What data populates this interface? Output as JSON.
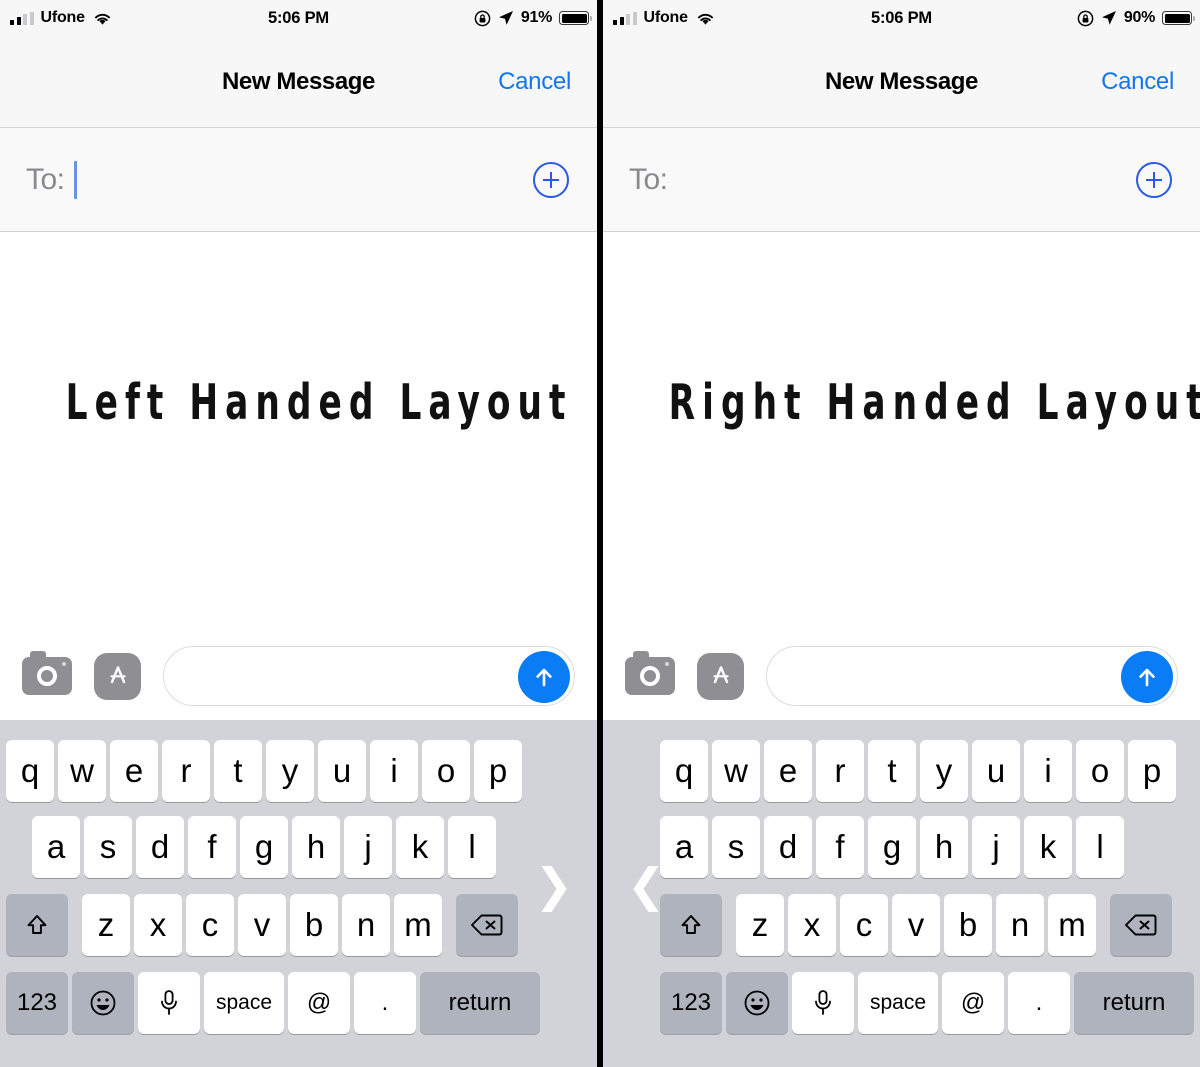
{
  "panels": [
    {
      "id": "left",
      "status": {
        "carrier": "Ufone",
        "time": "5:06 PM",
        "battery_pct": "91%",
        "signal_bars_filled": 2,
        "signal_bars_total": 4,
        "wifi_icon": "wifi-icon",
        "rotation_lock_icon": "rotation-lock-icon",
        "location_icon": "location-arrow-icon",
        "battery_icon": "battery-full-icon"
      },
      "nav": {
        "title": "New Message",
        "cancel_label": "Cancel"
      },
      "recipients": {
        "to_label": "To:",
        "value": "",
        "caret_visible": true,
        "add_contact_icon": "plus-circle-icon"
      },
      "headline": "Left Handed Layout",
      "input_bar": {
        "camera_icon": "camera-icon",
        "appstore_icon": "app-store-icon",
        "message_placeholder": "",
        "message_value": "",
        "send_icon": "send-arrow-up-icon"
      },
      "keyboard": {
        "align": "left",
        "row1": [
          "q",
          "w",
          "e",
          "r",
          "t",
          "y",
          "u",
          "i",
          "o",
          "p"
        ],
        "row2": [
          "a",
          "s",
          "d",
          "f",
          "g",
          "h",
          "j",
          "k",
          "l"
        ],
        "row3": [
          "z",
          "x",
          "c",
          "v",
          "b",
          "n",
          "m"
        ],
        "shift_icon": "shift-arrow-up-icon",
        "backspace_icon": "backspace-delete-icon",
        "numbers_label": "123",
        "emoji_icon": "emoji-smiley-icon",
        "dictation_icon": "microphone-icon",
        "space_label": "space",
        "at_label": "@",
        "period_label": ".",
        "return_label": "return",
        "switch_side_chevron": "chevron-right-icon"
      }
    },
    {
      "id": "right",
      "status": {
        "carrier": "Ufone",
        "time": "5:06 PM",
        "battery_pct": "90%",
        "signal_bars_filled": 2,
        "signal_bars_total": 4,
        "wifi_icon": "wifi-icon",
        "rotation_lock_icon": "rotation-lock-icon",
        "location_icon": "location-arrow-icon",
        "battery_icon": "battery-full-icon"
      },
      "nav": {
        "title": "New Message",
        "cancel_label": "Cancel"
      },
      "recipients": {
        "to_label": "To:",
        "value": "",
        "caret_visible": false,
        "add_contact_icon": "plus-circle-icon"
      },
      "headline": "Right Handed Layout",
      "input_bar": {
        "camera_icon": "camera-icon",
        "appstore_icon": "app-store-icon",
        "message_placeholder": "",
        "message_value": "",
        "send_icon": "send-arrow-up-icon"
      },
      "keyboard": {
        "align": "right",
        "row1": [
          "q",
          "w",
          "e",
          "r",
          "t",
          "y",
          "u",
          "i",
          "o",
          "p"
        ],
        "row2": [
          "a",
          "s",
          "d",
          "f",
          "g",
          "h",
          "j",
          "k",
          "l"
        ],
        "row3": [
          "z",
          "x",
          "c",
          "v",
          "b",
          "n",
          "m"
        ],
        "shift_icon": "shift-arrow-up-icon",
        "backspace_icon": "backspace-delete-icon",
        "numbers_label": "123",
        "emoji_icon": "emoji-smiley-icon",
        "dictation_icon": "microphone-icon",
        "space_label": "space",
        "at_label": "@",
        "period_label": ".",
        "return_label": "return",
        "switch_side_chevron": "chevron-left-icon"
      }
    }
  ],
  "colors": {
    "accent_blue": "#0a7cf6",
    "link_blue": "#1176f0",
    "plus_blue": "#2a58e8",
    "keyboard_bg": "#d1d3d9",
    "key_dark": "#aeb3bd",
    "chrome_gray": "#f7f7f7",
    "divider_black": "#000000",
    "icon_gray": "#8e8e93"
  }
}
